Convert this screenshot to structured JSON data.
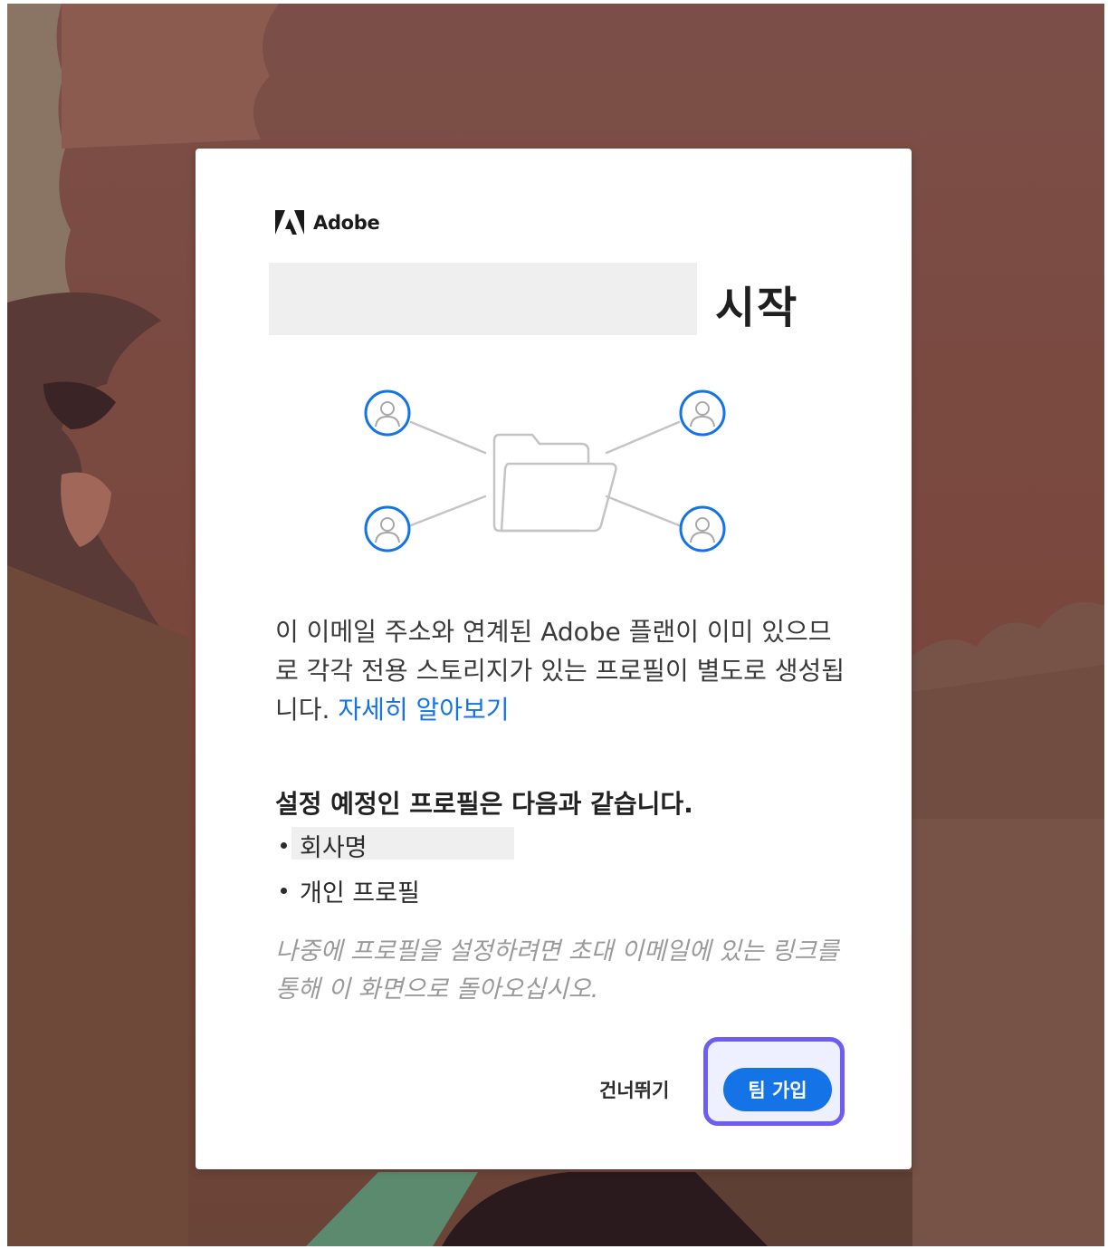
{
  "brand": {
    "name": "Adobe"
  },
  "dialog": {
    "title": "시작",
    "description_text": "이 이메일 주소와 연계된 Adobe 플랜이 이미 있으므로 각각 전용 스토리지가 있는 프로필이 별도로 생성됩니다. ",
    "learn_more_link": "자세히 알아보기",
    "profiles_heading": "설정 예정인 프로필은 다음과 같습니다.",
    "profiles": [
      {
        "label": "회사명"
      },
      {
        "label": "개인 프로필"
      }
    ],
    "note": "나중에 프로필을 설정하려면 초대 이메일에 있는 링크를 통해 이 화면으로 돌아오십시오.",
    "skip_label": "건너뛰기",
    "join_label": "팀 가입"
  },
  "colors": {
    "accent": "#1473e6",
    "focus_ring": "#6e5df0",
    "background_main": "#7a4a40"
  },
  "icons": {
    "logo": "adobe-logo-icon",
    "users": "user-circle-icon",
    "folder": "shared-folder-icon"
  }
}
